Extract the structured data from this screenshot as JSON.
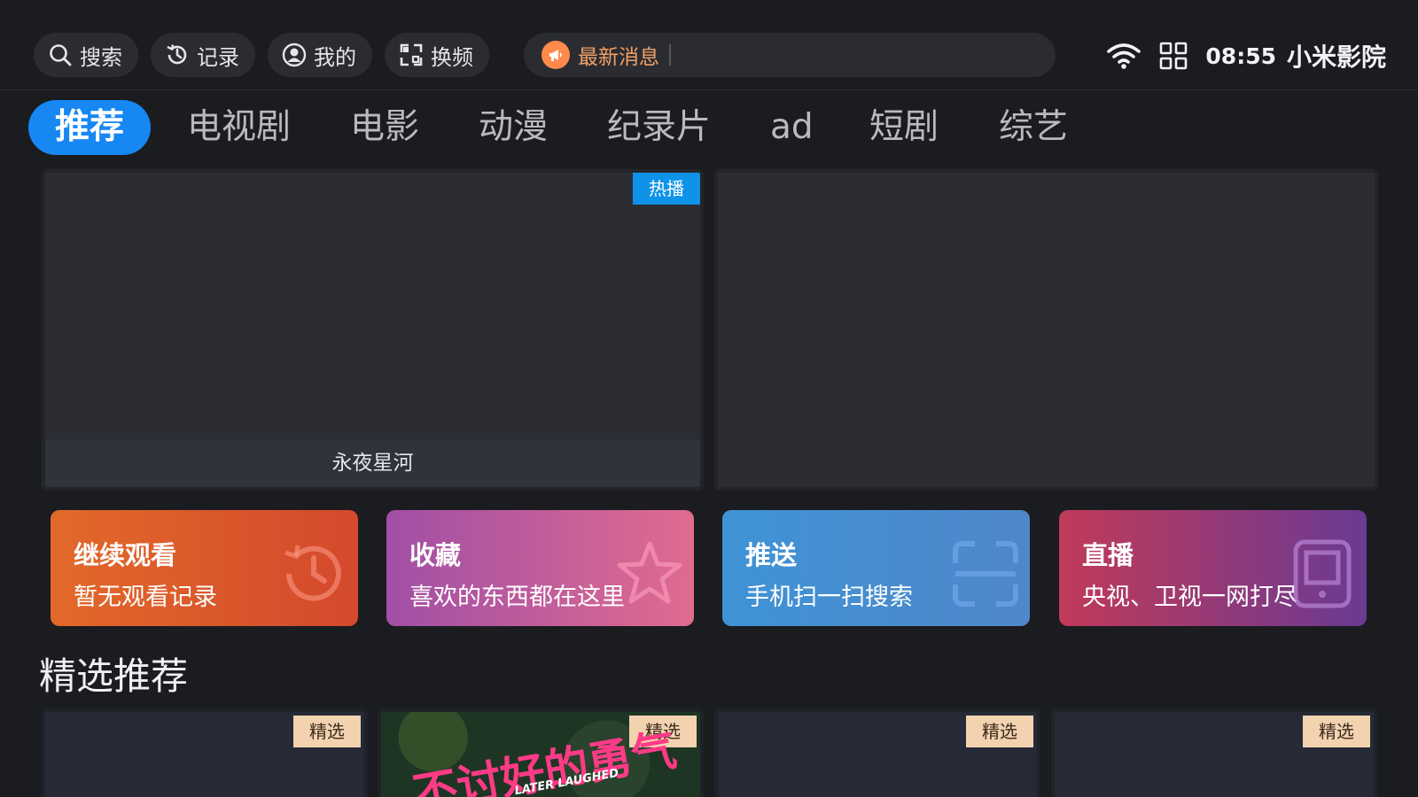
{
  "topbar": {
    "search_label": "搜索",
    "history_label": "记录",
    "profile_label": "我的",
    "switch_label": "换频",
    "news_label": "最新消息",
    "clock": "08:55",
    "brand": "小米影院"
  },
  "tabs": [
    {
      "label": "推荐",
      "active": true
    },
    {
      "label": "电视剧"
    },
    {
      "label": "电影"
    },
    {
      "label": "动漫"
    },
    {
      "label": "纪录片"
    },
    {
      "label": "ad"
    },
    {
      "label": "短剧"
    },
    {
      "label": "综艺"
    }
  ],
  "hero": {
    "left_caption": "永夜星河",
    "left_badge": "热播"
  },
  "cards": {
    "continue": {
      "title": "继续观看",
      "sub": "暂无观看记录"
    },
    "favorites": {
      "title": "收藏",
      "sub": "喜欢的东西都在这里"
    },
    "push": {
      "title": "推送",
      "sub": "手机扫一扫搜索"
    },
    "live": {
      "title": "直播",
      "sub": "央视、卫视一网打尽"
    }
  },
  "featured": {
    "title": "精选推荐",
    "badge": "精选",
    "poster_title": "不讨好的勇气",
    "poster_subtitle": "LATER LAUGHED"
  },
  "colors": {
    "accent": "#1787f3",
    "background": "#1b1c20",
    "hot_badge": "#0f93e8",
    "pick_badge": "#f3d2b0"
  }
}
